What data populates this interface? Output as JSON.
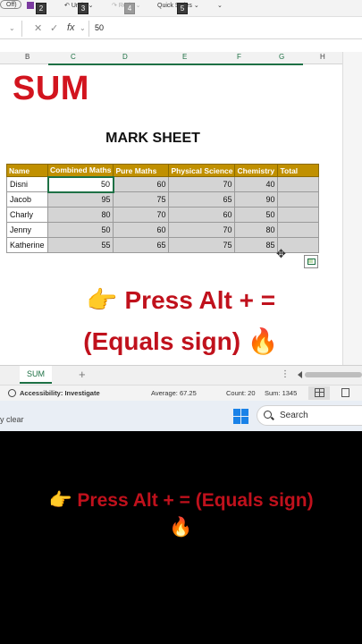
{
  "ribbon": {
    "off_label": "Off)",
    "save_label": "ave",
    "undo_label": "Undo",
    "redo_label": "Redo",
    "quick_styles_label": "Quick Styles",
    "key_tips": [
      "2",
      "3",
      "4",
      "5"
    ]
  },
  "formula_bar": {
    "cancel_symbol": "✕",
    "enter_symbol": "✓",
    "fx_symbol": "fx",
    "value": "50"
  },
  "columns": [
    "B",
    "C",
    "D",
    "E",
    "F",
    "G",
    "H"
  ],
  "sheet": {
    "big_title": "SUM",
    "table_title": "MARK SHEET",
    "headers": [
      "Name",
      "Combined Maths",
      "Pure Maths",
      "Physical Science",
      "Chemistry",
      "Total"
    ],
    "rows": [
      {
        "name": "Disni",
        "values": [
          "50",
          "60",
          "70",
          "40"
        ],
        "total": ""
      },
      {
        "name": "Jacob",
        "values": [
          "95",
          "75",
          "65",
          "90"
        ],
        "total": ""
      },
      {
        "name": "Charly",
        "values": [
          "80",
          "70",
          "60",
          "50"
        ],
        "total": ""
      },
      {
        "name": "Jenny",
        "values": [
          "50",
          "60",
          "70",
          "80"
        ],
        "total": ""
      },
      {
        "name": "Katherine",
        "values": [
          "55",
          "65",
          "75",
          "85"
        ],
        "total": ""
      }
    ]
  },
  "caption_top": {
    "line1": "👉 Press Alt + =",
    "line2": "(Equals sign) 🔥"
  },
  "tabs": {
    "active_sheet": "SUM",
    "add_label": "+",
    "more_label": "⋮"
  },
  "status": {
    "accessibility": "Accessibility: Investigate",
    "average": "Average: 67.25",
    "count": "Count: 20",
    "sum": "Sum: 1345"
  },
  "taskbar": {
    "left_text": "y clear",
    "search_label": "Search"
  },
  "caption_bottom": {
    "line1": "👉 Press Alt + = (Equals sign)",
    "line2": "🔥"
  },
  "colors": {
    "header_gold": "#c09000",
    "title_red": "#d2141e",
    "excel_green": "#1e7145"
  }
}
